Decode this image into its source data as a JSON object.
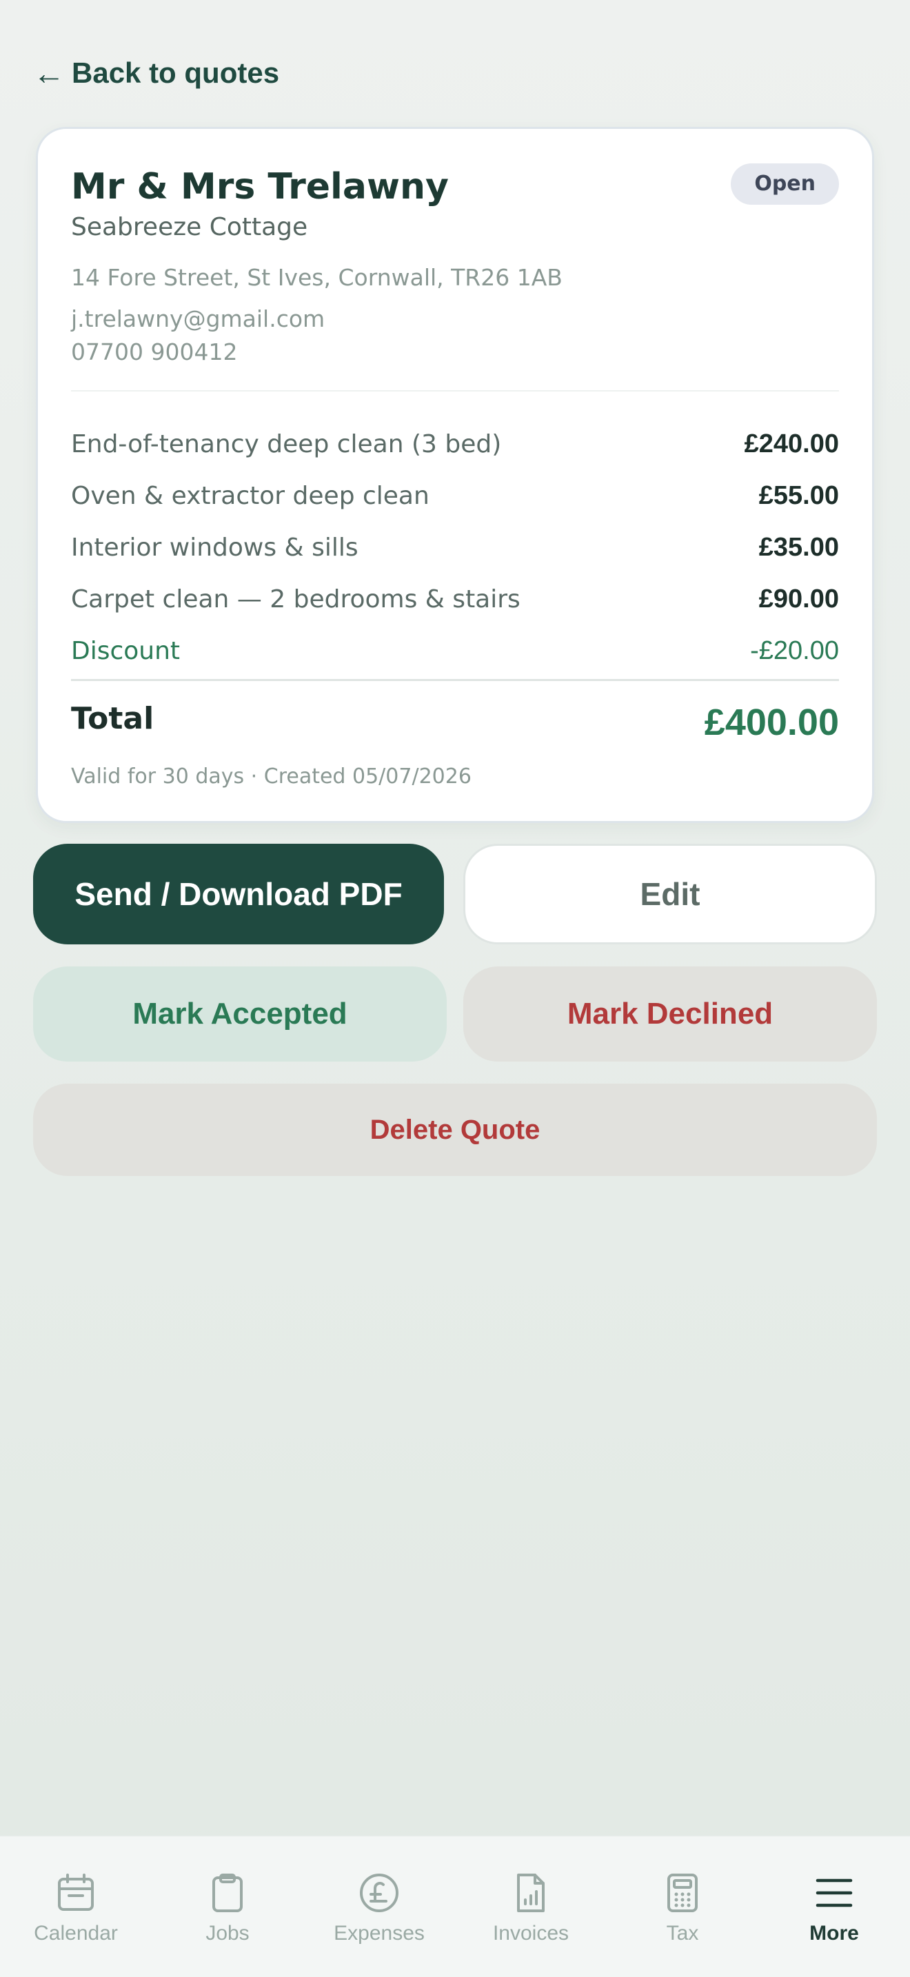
{
  "nav": {
    "back_label": "Back to quotes"
  },
  "quote": {
    "client_name": "Mr & Mrs Trelawny",
    "status": "Open",
    "property": "Seabreeze Cottage",
    "address": "14 Fore Street, St Ives, Cornwall, TR26 1AB",
    "email": "j.trelawny@gmail.com",
    "phone": "07700 900412",
    "line_items": [
      {
        "description": "End-of-tenancy deep clean (3 bed)",
        "amount": "£240.00"
      },
      {
        "description": "Oven & extractor deep clean",
        "amount": "£55.00"
      },
      {
        "description": "Interior windows & sills",
        "amount": "£35.00"
      },
      {
        "description": "Carpet clean — 2 bedrooms & stairs",
        "amount": "£90.00"
      }
    ],
    "discount": {
      "label": "Discount",
      "amount": "-£20.00"
    },
    "total_label": "Total",
    "total_amount": "£400.00",
    "meta": "Valid for 30 days · Created 05/07/2026"
  },
  "actions": {
    "send": "Send / Download PDF",
    "edit": "Edit",
    "accept": "Mark Accepted",
    "decline": "Mark Declined",
    "delete": "Delete Quote"
  },
  "tabbar": {
    "items": [
      {
        "label": "Calendar",
        "icon": "calendar-icon"
      },
      {
        "label": "Jobs",
        "icon": "clipboard-icon"
      },
      {
        "label": "Expenses",
        "icon": "pound-coin-icon"
      },
      {
        "label": "Invoices",
        "icon": "invoice-chart-icon"
      },
      {
        "label": "Tax",
        "icon": "calculator-icon"
      },
      {
        "label": "More",
        "icon": "menu-icon",
        "active": true
      }
    ]
  },
  "colors": {
    "primary": "#1f4a40",
    "accent_green": "#2a7a55",
    "danger_red": "#b23a3a"
  }
}
